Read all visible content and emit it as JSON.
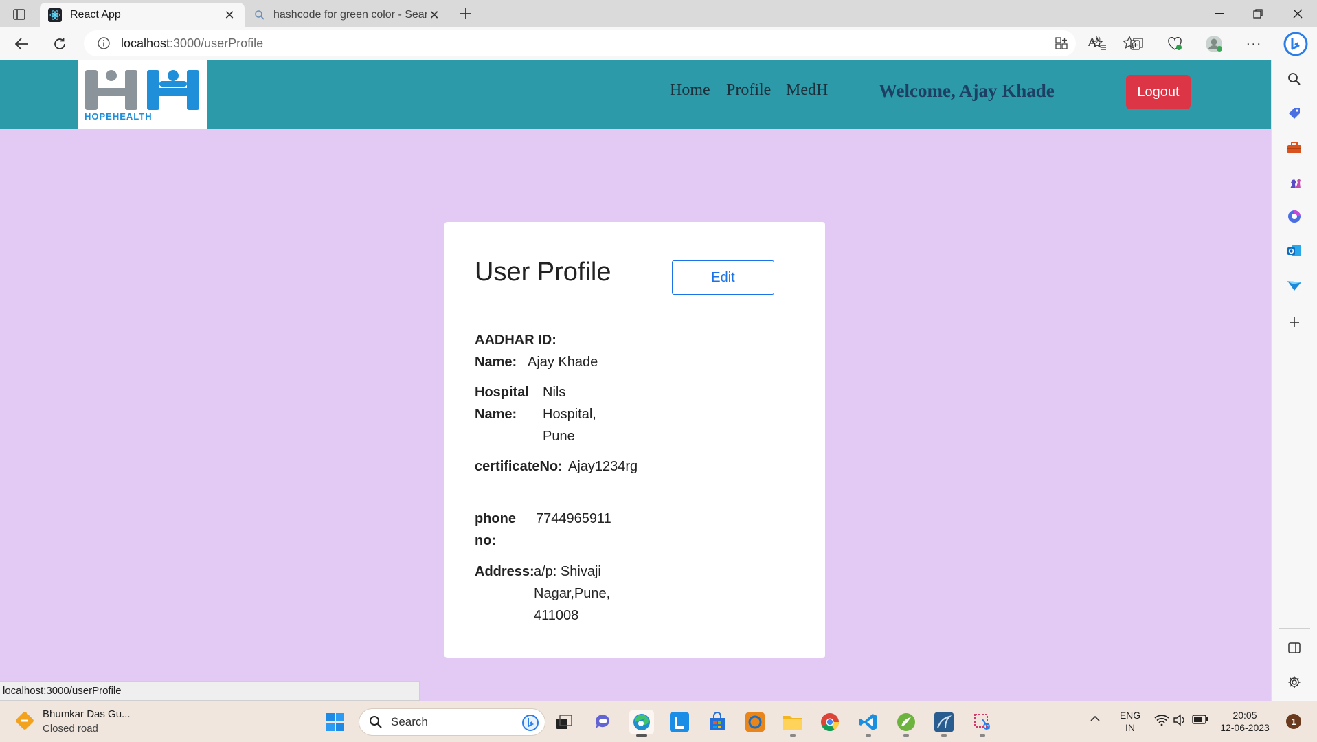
{
  "browser": {
    "tabs": [
      {
        "title": "React App",
        "active": true
      },
      {
        "title": "hashcode for green color - Searc",
        "active": false
      }
    ],
    "url": {
      "host": "localhost",
      "path": ":3000/userProfile"
    },
    "status_link": "localhost:3000/userProfile"
  },
  "app": {
    "logo_text": "HOPEHEALTH",
    "nav": [
      "Home",
      "Profile",
      "MedH"
    ],
    "welcome": "Welcome, Ajay Khade",
    "logout_label": "Logout"
  },
  "profile": {
    "title": "User Profile",
    "edit_label": "Edit",
    "fields": {
      "aadhar_label": "AADHAR ID:",
      "aadhar_value": "",
      "name_label": "Name:",
      "name_value": "Ajay Khade",
      "hospital_label_1": "Hospital",
      "hospital_label_2": "Name:",
      "hospital_value_1": "Nils",
      "hospital_value_2": "Hospital,",
      "hospital_value_3": "Pune",
      "cert_label": "certificateNo:",
      "cert_value": "Ajay1234rg",
      "phone_label_1": "phone",
      "phone_label_2": "no:",
      "phone_value": "7744965911",
      "address_label": "Address:",
      "address_value_1": "a/p: Shivaji",
      "address_value_2": "Nagar,Pune,",
      "address_value_3": "411008"
    }
  },
  "taskbar": {
    "weather_title": "Bhumkar Das Gu...",
    "weather_sub": "Closed road",
    "search_placeholder": "Search",
    "lang_1": "ENG",
    "lang_2": "IN",
    "time": "20:05",
    "date": "12-06-2023",
    "notification_count": "1"
  },
  "colors": {
    "app_header": "#2c9aa8",
    "page_bg": "#e3caf5",
    "logout": "#dc3545",
    "edit_accent": "#1a73e8"
  }
}
